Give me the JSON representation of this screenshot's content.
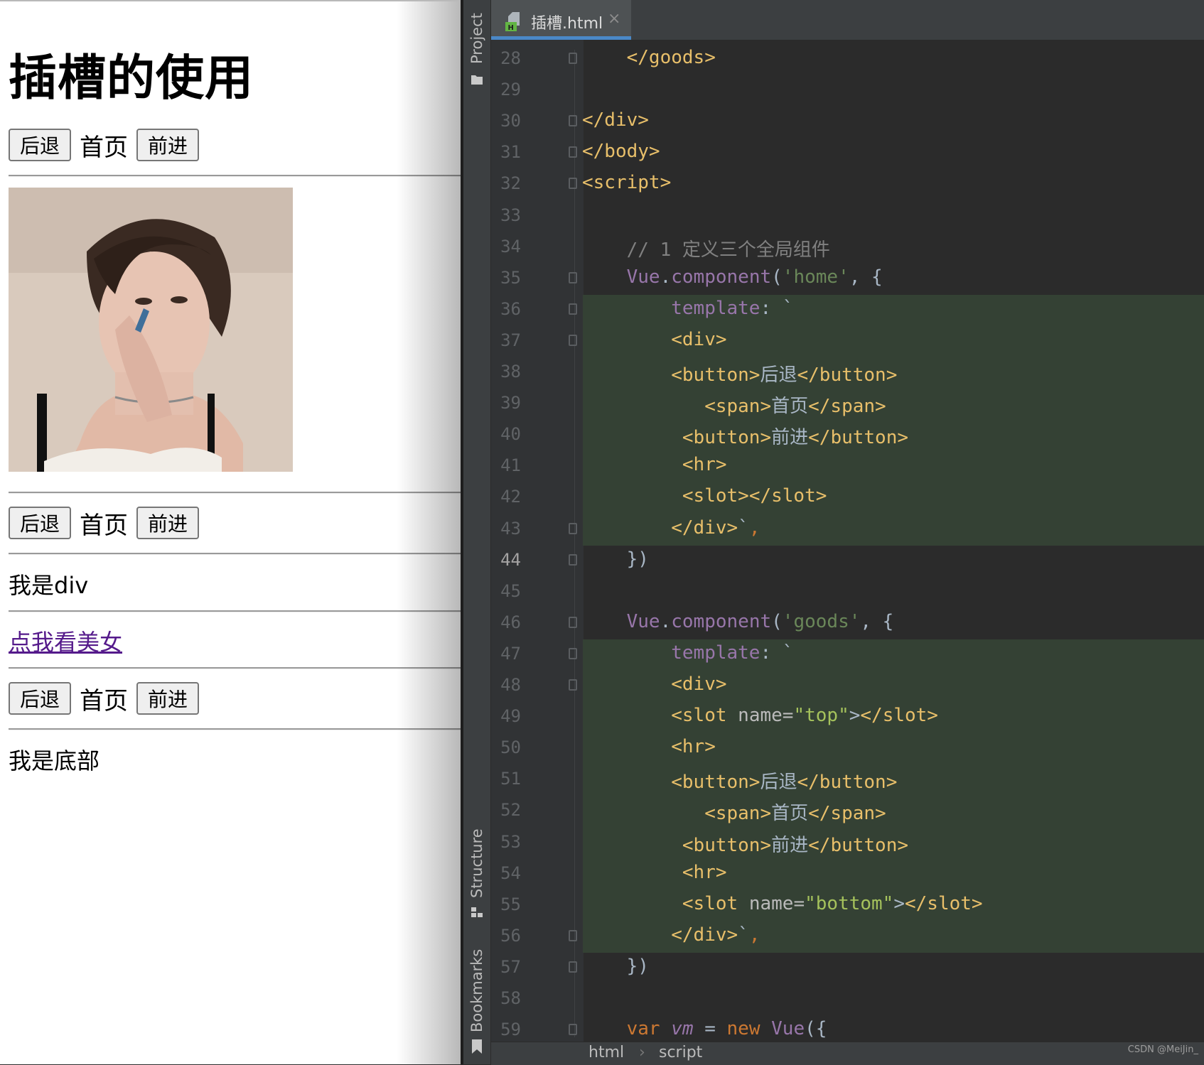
{
  "browser": {
    "heading": "插槽的使用",
    "nav": {
      "back": "后退",
      "home": "首页",
      "forward": "前进"
    },
    "div_text": "我是div",
    "link_text": "点我看美女",
    "bottom_text": "我是底部"
  },
  "ide": {
    "tab": {
      "filename": "插槽.html",
      "close": "×"
    },
    "toolwindows": {
      "project": "Project",
      "structure": "Structure",
      "bookmarks": "Bookmarks"
    },
    "breadcrumb": [
      "html",
      "script"
    ],
    "breadcrumb_sep": "›",
    "current_line": 44,
    "lines": [
      {
        "n": "28",
        "t": "    </goods>"
      },
      {
        "n": "29",
        "t": ""
      },
      {
        "n": "30",
        "t": "</div>"
      },
      {
        "n": "31",
        "t": "</body>"
      },
      {
        "n": "32",
        "t": "<script>"
      },
      {
        "n": "33",
        "t": ""
      },
      {
        "n": "34",
        "t": "    // 1 定义三个全局组件"
      },
      {
        "n": "35",
        "t": "    Vue.component('home', {"
      },
      {
        "n": "36",
        "t": "        template: `"
      },
      {
        "n": "37",
        "t": "        <div>"
      },
      {
        "n": "38",
        "t": "        <button>后退</button>"
      },
      {
        "n": "39",
        "t": "           <span>首页</span>"
      },
      {
        "n": "40",
        "t": "         <button>前进</button>"
      },
      {
        "n": "41",
        "t": "         <hr>"
      },
      {
        "n": "42",
        "t": "         <slot></slot>"
      },
      {
        "n": "43",
        "t": "        </div>`,"
      },
      {
        "n": "44",
        "t": "    })"
      },
      {
        "n": "45",
        "t": ""
      },
      {
        "n": "46",
        "t": "    Vue.component('goods', {"
      },
      {
        "n": "47",
        "t": "        template: `"
      },
      {
        "n": "48",
        "t": "        <div>"
      },
      {
        "n": "49",
        "t": "        <slot name=\"top\"></slot>"
      },
      {
        "n": "50",
        "t": "        <hr>"
      },
      {
        "n": "51",
        "t": "        <button>后退</button>"
      },
      {
        "n": "52",
        "t": "           <span>首页</span>"
      },
      {
        "n": "53",
        "t": "         <button>前进</button>"
      },
      {
        "n": "54",
        "t": "         <hr>"
      },
      {
        "n": "55",
        "t": "         <slot name=\"bottom\"></slot>"
      },
      {
        "n": "56",
        "t": "        </div>`,"
      },
      {
        "n": "57",
        "t": "    })"
      },
      {
        "n": "58",
        "t": ""
      },
      {
        "n": "59",
        "t": "    var vm = new Vue({"
      }
    ]
  },
  "credit": "CSDN @MeiJin_",
  "colors": {
    "editor_bg": "#2b2b2b",
    "tag": "#e8bf6a",
    "string": "#6a8759",
    "keyword": "#cc7832",
    "member": "#9876aa",
    "comment": "#808080",
    "template_highlight": "#344134",
    "tab_underline": "#4a88c7"
  }
}
